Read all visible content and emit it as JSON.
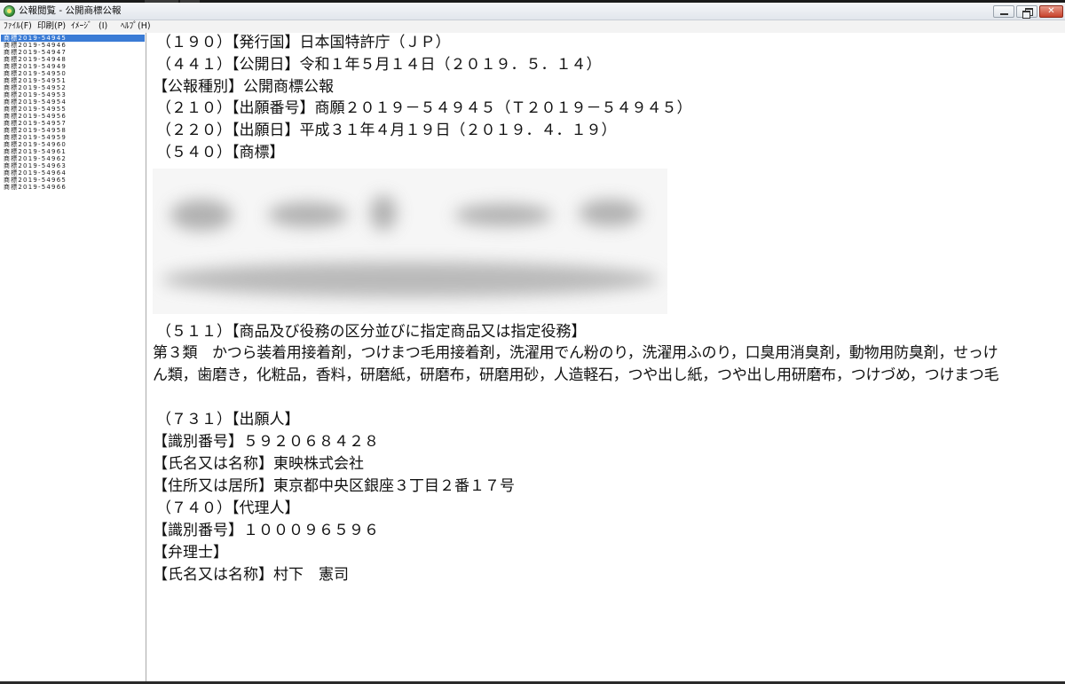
{
  "window": {
    "title": "公報閲覧 - 公開商標公報",
    "buttons": {
      "minimize": "‒",
      "maximize": "",
      "close": "✕"
    }
  },
  "menu": [
    {
      "label": "ﾌｧｲﾙ(F)"
    },
    {
      "label": "印刷(P)"
    },
    {
      "label": "ｲﾒｰｼﾞ"
    },
    {
      "label": "(I)"
    },
    {
      "label": "ﾍﾙﾌﾟ(H)"
    }
  ],
  "sidebar": {
    "selected_index": 0,
    "items": [
      {
        "label": "商標2019-54945"
      },
      {
        "label": "商標2019-54946"
      },
      {
        "label": "商標2019-54947"
      },
      {
        "label": "商標2019-54948"
      },
      {
        "label": "商標2019-54949"
      },
      {
        "label": "商標2019-54950"
      },
      {
        "label": "商標2019-54951"
      },
      {
        "label": "商標2019-54952"
      },
      {
        "label": "商標2019-54953"
      },
      {
        "label": "商標2019-54954"
      },
      {
        "label": "商標2019-54955"
      },
      {
        "label": "商標2019-54956"
      },
      {
        "label": "商標2019-54957"
      },
      {
        "label": "商標2019-54958"
      },
      {
        "label": "商標2019-54959"
      },
      {
        "label": "商標2019-54960"
      },
      {
        "label": "商標2019-54961"
      },
      {
        "label": "商標2019-54962"
      },
      {
        "label": "商標2019-54963"
      },
      {
        "label": "商標2019-54964"
      },
      {
        "label": "商標2019-54965"
      },
      {
        "label": "商標2019-54966"
      }
    ]
  },
  "document": {
    "issuing_country": "（１９０）【発行国】日本国特許庁（ＪＰ）",
    "publication_date": "（４４１）【公開日】令和１年５月１４日（２０１９．５．１４）",
    "gazette_type": "【公報種別】公開商標公報",
    "application_number": "（２１０）【出願番号】商願２０１９－５４９４５（Ｔ２０１９－５４９４５）",
    "application_date": "（２２０）【出願日】平成３１年４月１９日（２０１９．４．１９）",
    "trademark_heading": "（５４０）【商標】",
    "classification_heading": "（５１１）【商品及び役務の区分並びに指定商品又は指定役務】",
    "goods_line1": "第３類　かつら装着用接着剤，つけまつ毛用接着剤，洗濯用でん粉のり，洗濯用ふのり，口臭用消臭剤，動物用防臭剤，せっけ",
    "goods_line2": "ん類，歯磨き，化粧品，香料，研磨紙，研磨布，研磨用砂，人造軽石，つや出し紙，つや出し用研磨布，つけづめ，つけまつ毛",
    "applicant_heading": "（７３１）【出願人】",
    "applicant_id": "【識別番号】５９２０６８４２８",
    "applicant_name": "【氏名又は名称】東映株式会社",
    "applicant_address": "【住所又は居所】東京都中央区銀座３丁目２番１７号",
    "agent_heading": "（７４０）【代理人】",
    "agent_id": "【識別番号】１０００９６５９６",
    "agent_title": "【弁理士】",
    "agent_name": "【氏名又は名称】村下　憲司"
  }
}
